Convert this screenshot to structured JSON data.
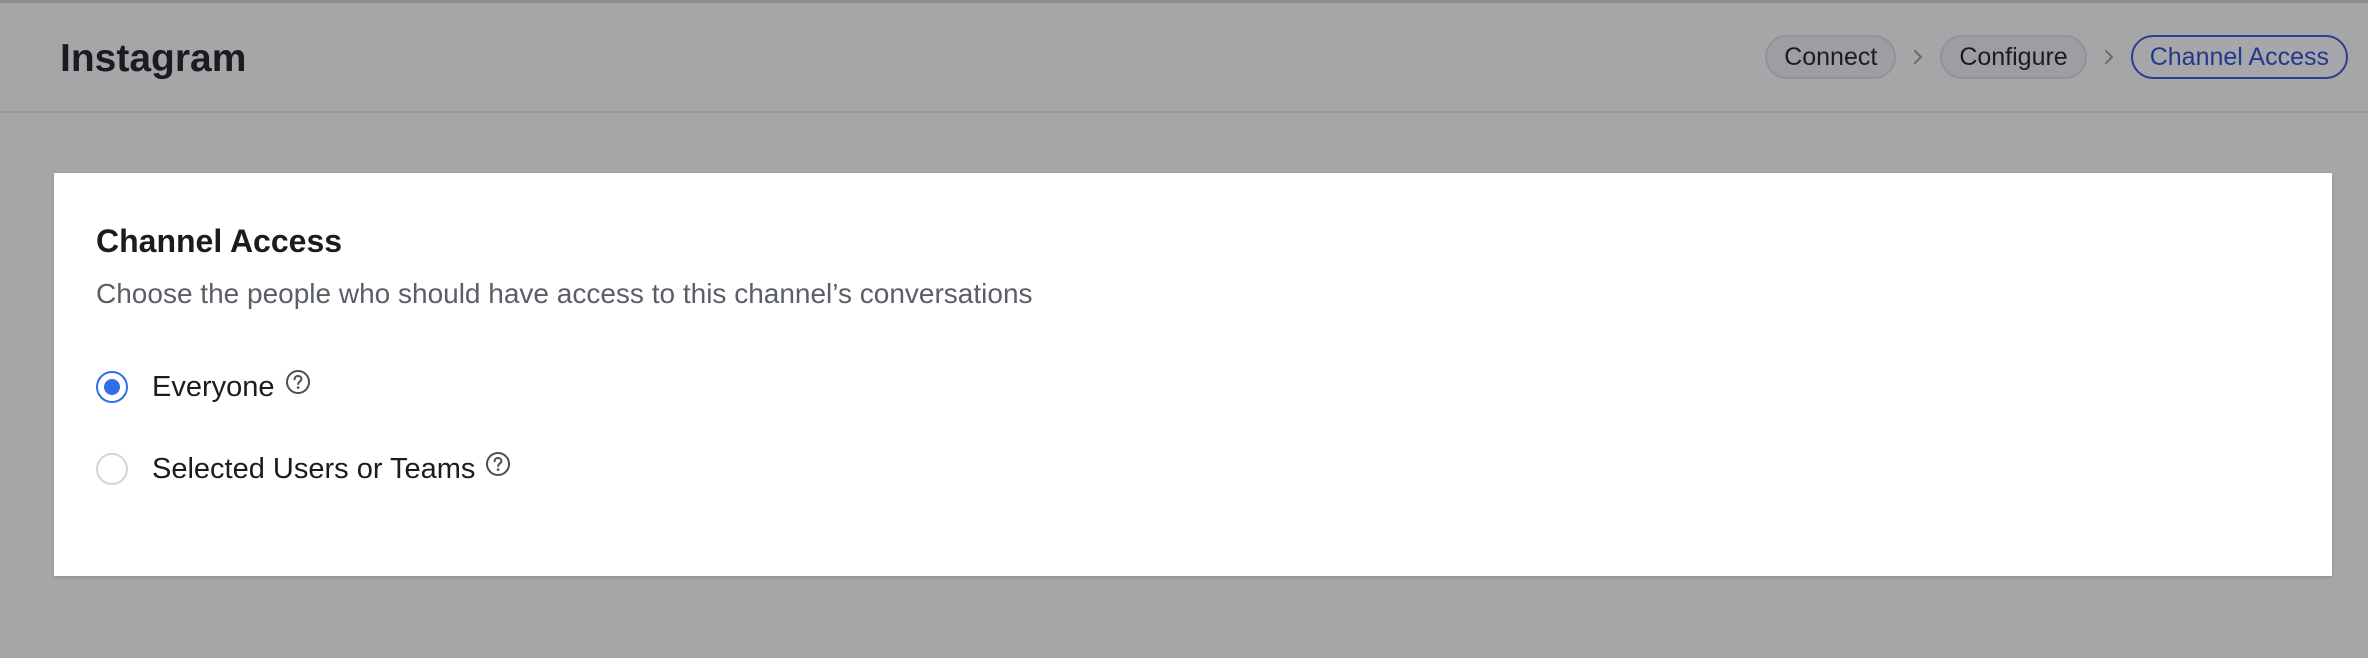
{
  "header": {
    "title": "Instagram",
    "steps": [
      {
        "label": "Connect",
        "active": false
      },
      {
        "label": "Configure",
        "active": false
      },
      {
        "label": "Channel Access",
        "active": true
      }
    ]
  },
  "card": {
    "title": "Channel Access",
    "description": "Choose the people who should have access to this channel’s conversations",
    "options": [
      {
        "label": "Everyone",
        "selected": true,
        "icon": "help-circle-icon"
      },
      {
        "label": "Selected Users or Teams",
        "selected": false,
        "icon": "help-circle-icon"
      }
    ]
  },
  "colors": {
    "accent": "#2f6fe8",
    "active_step": "#2b3f8e",
    "overlay_bg": "#a5a6a8"
  }
}
